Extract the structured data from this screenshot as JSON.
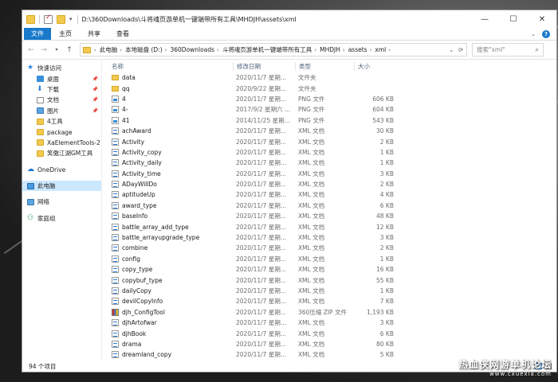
{
  "window": {
    "title_path": "D:\\360Downloads\\斗将魂页游单机一键端带所有工具\\MHDJH\\assets\\xml",
    "controls": {
      "minimize": "—",
      "maximize": "☐",
      "close": "✕"
    }
  },
  "ribbon": {
    "tabs": [
      "文件",
      "主页",
      "共享",
      "查看"
    ]
  },
  "address": {
    "crumbs": [
      "此电脑",
      "本地磁盘 (D:)",
      "360Downloads",
      "斗将魂页游单机一键端带所有工具",
      "MHDJH",
      "assets",
      "xml"
    ],
    "search_placeholder": "搜索\"xml\""
  },
  "sidebar": {
    "items": [
      {
        "label": "快速访问",
        "icon": "star-icon",
        "level": 1
      },
      {
        "label": "桌面",
        "icon": "desktop-icon",
        "level": 2,
        "pinned": true
      },
      {
        "label": "下载",
        "icon": "download-icon",
        "level": 2,
        "pinned": true
      },
      {
        "label": "文档",
        "icon": "document-icon",
        "level": 2,
        "pinned": true
      },
      {
        "label": "图片",
        "icon": "pictures-icon",
        "level": 2,
        "pinned": true
      },
      {
        "label": "4工具",
        "icon": "folder-icon",
        "level": 2
      },
      {
        "label": "package",
        "icon": "folder-icon",
        "level": 2
      },
      {
        "label": "XaElementTools-2",
        "icon": "folder-icon",
        "level": 2
      },
      {
        "label": "笑傲江湖GM工具",
        "icon": "folder-icon",
        "level": 2
      },
      {
        "label": "OneDrive",
        "icon": "cloud-icon",
        "level": 1,
        "gap": true
      },
      {
        "label": "此电脑",
        "icon": "computer-icon",
        "level": 1,
        "gap": true,
        "selected": true
      },
      {
        "label": "网络",
        "icon": "network-icon",
        "level": 1,
        "gap": true
      },
      {
        "label": "家庭组",
        "icon": "homegroup-icon",
        "level": 1,
        "gap": true
      }
    ]
  },
  "columns": {
    "name": "名称",
    "date": "修改日期",
    "type": "类型",
    "size": "大小"
  },
  "files": [
    {
      "name": "data",
      "date": "2020/11/7 星期...",
      "type": "文件夹",
      "size": "",
      "kind": "folder"
    },
    {
      "name": "qq",
      "date": "2020/9/22 星期...",
      "type": "文件夹",
      "size": "",
      "kind": "folder"
    },
    {
      "name": "4",
      "date": "2020/11/7 星期...",
      "type": "PNG 文件",
      "size": "606 KB",
      "kind": "png"
    },
    {
      "name": "4-",
      "date": "2017/9/2 星期六 ...",
      "type": "PNG 文件",
      "size": "604 KB",
      "kind": "png"
    },
    {
      "name": "41",
      "date": "2014/11/25 星期...",
      "type": "PNG 文件",
      "size": "543 KB",
      "kind": "png"
    },
    {
      "name": "achAward",
      "date": "2020/11/7 星期...",
      "type": "XML 文档",
      "size": "30 KB",
      "kind": "xml"
    },
    {
      "name": "Activity",
      "date": "2020/11/7 星期...",
      "type": "XML 文档",
      "size": "2 KB",
      "kind": "xml"
    },
    {
      "name": "Activity_copy",
      "date": "2020/11/7 星期...",
      "type": "XML 文档",
      "size": "1 KB",
      "kind": "xml"
    },
    {
      "name": "Activity_daily",
      "date": "2020/11/7 星期...",
      "type": "XML 文档",
      "size": "1 KB",
      "kind": "xml"
    },
    {
      "name": "Activity_time",
      "date": "2020/11/7 星期...",
      "type": "XML 文档",
      "size": "3 KB",
      "kind": "xml"
    },
    {
      "name": "ADayWillDo",
      "date": "2020/11/7 星期...",
      "type": "XML 文档",
      "size": "2 KB",
      "kind": "xml"
    },
    {
      "name": "aptitudeUp",
      "date": "2020/11/7 星期...",
      "type": "XML 文档",
      "size": "4 KB",
      "kind": "xml"
    },
    {
      "name": "award_type",
      "date": "2020/11/7 星期...",
      "type": "XML 文档",
      "size": "6 KB",
      "kind": "xml"
    },
    {
      "name": "baseInfo",
      "date": "2020/11/7 星期...",
      "type": "XML 文档",
      "size": "48 KB",
      "kind": "xml"
    },
    {
      "name": "battle_array_add_type",
      "date": "2020/11/7 星期...",
      "type": "XML 文档",
      "size": "12 KB",
      "kind": "xml"
    },
    {
      "name": "battle_arrayupgrade_type",
      "date": "2020/11/7 星期...",
      "type": "XML 文档",
      "size": "3 KB",
      "kind": "xml"
    },
    {
      "name": "combine",
      "date": "2020/11/7 星期...",
      "type": "XML 文档",
      "size": "2 KB",
      "kind": "xml"
    },
    {
      "name": "config",
      "date": "2020/11/7 星期...",
      "type": "XML 文档",
      "size": "1 KB",
      "kind": "xml"
    },
    {
      "name": "copy_type",
      "date": "2020/11/7 星期...",
      "type": "XML 文档",
      "size": "16 KB",
      "kind": "xml"
    },
    {
      "name": "copybuf_type",
      "date": "2020/11/7 星期...",
      "type": "XML 文档",
      "size": "55 KB",
      "kind": "xml"
    },
    {
      "name": "dailyCopy",
      "date": "2020/11/7 星期...",
      "type": "XML 文档",
      "size": "1 KB",
      "kind": "xml"
    },
    {
      "name": "devilCopyInfo",
      "date": "2020/11/7 星期...",
      "type": "XML 文档",
      "size": "7 KB",
      "kind": "xml"
    },
    {
      "name": "djh_ConfigTool",
      "date": "2020/11/7 星期...",
      "type": "360压缩 ZIP 文件",
      "size": "1,193 KB",
      "kind": "zip"
    },
    {
      "name": "djhArtofwar",
      "date": "2020/11/7 星期...",
      "type": "XML 文档",
      "size": "3 KB",
      "kind": "xml"
    },
    {
      "name": "djhBook",
      "date": "2020/11/7 星期...",
      "type": "XML 文档",
      "size": "6 KB",
      "kind": "xml"
    },
    {
      "name": "drama",
      "date": "2020/11/7 星期...",
      "type": "XML 文档",
      "size": "80 KB",
      "kind": "xml"
    },
    {
      "name": "dreamland_copy",
      "date": "2020/11/7 星期...",
      "type": "XML 文档",
      "size": "5 KB",
      "kind": "xml"
    }
  ],
  "status": {
    "item_count": "94 个项目"
  },
  "watermark": {
    "line1": "热血侠网游单机论坛",
    "line2": "www.cxuexia.com"
  }
}
